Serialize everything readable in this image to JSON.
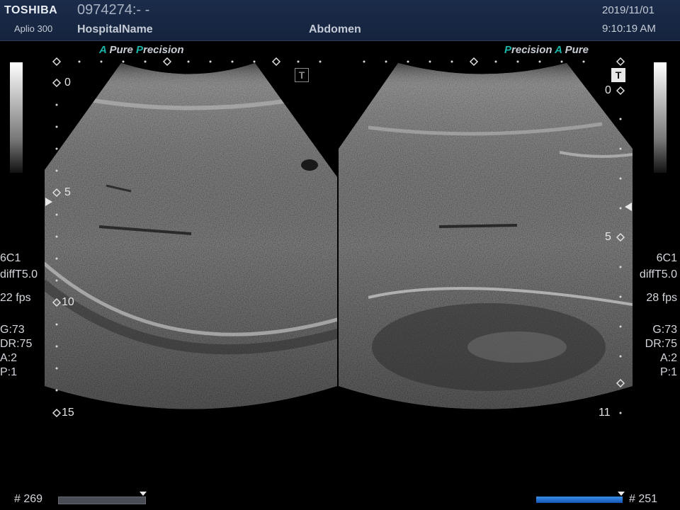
{
  "header": {
    "brand": "TOSHIBA",
    "model": "Aplio 300",
    "patient_id": "0974274:- -",
    "hospital": "HospitalName",
    "exam": "Abdomen",
    "date": "2019/11/01",
    "time": "9:10:19 AM"
  },
  "left_panel": {
    "preset_a": "A",
    "preset_pure": " Pure ",
    "preset_p": "P",
    "preset_precision": "recision",
    "depth_marks": [
      "0",
      "5",
      "10",
      "15"
    ],
    "probe": "6C1",
    "mode": "diffT5.0",
    "fps": "22 fps",
    "gain": "G:73",
    "dynamic_range": "DR:75",
    "a_param": "A:2",
    "p_param": "P:1",
    "frame_count": "# 269",
    "t_icon": "T"
  },
  "right_panel": {
    "preset_p": "P",
    "preset_precision": "recision ",
    "preset_a": "A",
    "preset_pure": " Pure",
    "depth_marks": [
      "0",
      "5",
      "11"
    ],
    "probe": "6C1",
    "mode": "diffT5.0",
    "fps": "28 fps",
    "gain": "G:73",
    "dynamic_range": "DR:75",
    "a_param": "A:2",
    "p_param": "P:1",
    "frame_count": "# 251",
    "t_icon": "T"
  },
  "colors": {
    "header_bg": "#1b2c4a",
    "accent_teal": "#1ab4a8",
    "cine_blue": "#1f6fd0",
    "background": "#000000"
  }
}
